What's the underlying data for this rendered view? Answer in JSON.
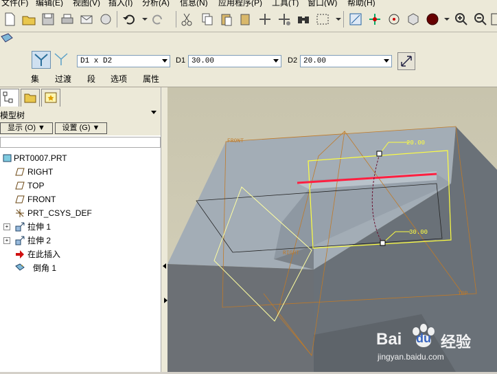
{
  "menu": {
    "items": [
      "文件(F)",
      "编辑(E)",
      "视图(V)",
      "插入(I)",
      "分析(A)",
      "信息(N)",
      "应用程序(P)",
      "工具(T)",
      "窗口(W)",
      "帮助(H)"
    ]
  },
  "dashboard": {
    "scheme_value": "D1 x D2",
    "d1_label": "D1",
    "d1_value": "30.00",
    "d2_label": "D2",
    "d2_value": "20.00",
    "tabs": [
      "集",
      "过渡",
      "段",
      "选项",
      "属性"
    ]
  },
  "sidebar": {
    "title": "模型树",
    "show_button": "显示 (O) ▼",
    "settings_button": "设置 (G) ▼",
    "tree": [
      {
        "label": "PRT0007.PRT",
        "icon": "part-icon"
      },
      {
        "label": "RIGHT",
        "icon": "datum-plane-icon"
      },
      {
        "label": "TOP",
        "icon": "datum-plane-icon"
      },
      {
        "label": "FRONT",
        "icon": "datum-plane-icon"
      },
      {
        "label": "PRT_CSYS_DEF",
        "icon": "csys-icon"
      },
      {
        "label": "拉伸 1",
        "icon": "extrude-icon"
      },
      {
        "label": "拉伸 2",
        "icon": "extrude-icon"
      },
      {
        "label": "在此插入",
        "icon": "insert-arrow-icon"
      },
      {
        "label": "倒角 1",
        "icon": "chamfer-icon"
      }
    ]
  },
  "viewport": {
    "labels": {
      "front": "FRONT",
      "right": "RIGHT",
      "top": "TOP",
      "dim_d2": "20.00",
      "dim_d1": "30.00"
    },
    "colors": {
      "background": "#cfcbb4",
      "datum": "#c07a28",
      "selected_edge": "#ff1f40",
      "preview": "#ffff40"
    }
  },
  "watermark": {
    "brand": "Bai",
    "brand2": "du",
    "cn": "经验",
    "url": "jingyan.baidu.com"
  }
}
